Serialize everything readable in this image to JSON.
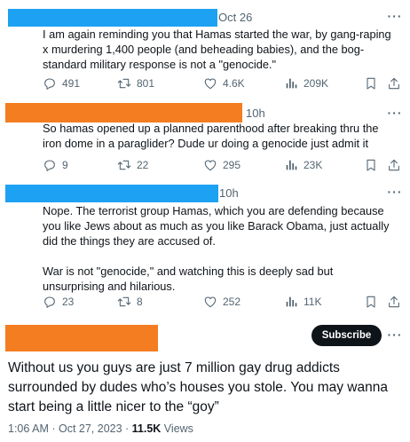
{
  "colors": {
    "blue_redaction": "#1da1f2",
    "orange_redaction": "#f47c21",
    "subscribe_bg": "#0f1419",
    "secondary_text": "#536471"
  },
  "icons": [
    "reply-icon",
    "retweet-icon",
    "like-icon",
    "views-icon",
    "bookmark-icon",
    "share-icon",
    "more-icon"
  ],
  "thread": [
    {
      "time": "Oct 26",
      "paragraphs": [
        "I am again reminding you that Hamas started the war, by gang-raping x murdering 1,400 people (and beheading babies), and the bog-standard military response is not a \"genocide.\""
      ],
      "replies": "491",
      "reposts": "801",
      "likes": "4.6K",
      "views": "209K"
    },
    {
      "time": "10h",
      "paragraphs": [
        "So hamas opened up a planned parenthood after breaking thru the iron dome in a paraglider? Dude ur doing a genocide just admit it"
      ],
      "replies": "9",
      "reposts": "22",
      "likes": "295",
      "views": "23K"
    },
    {
      "time": "10h",
      "paragraphs": [
        "Nope. The terrorist group Hamas, which you are defending because you like Jews about as much as you like Barack Obama, just actually did the things they are accused of.",
        "War is not \"genocide,\" and watching this is deeply sad but unsurprising and hilarious."
      ],
      "replies": "23",
      "reposts": "8",
      "likes": "252",
      "views": "11K"
    }
  ],
  "main": {
    "subscribe_label": "Subscribe",
    "text": "Without us you guys are just 7 million gay drug addicts surrounded by dudes who’s houses you stole. You may wanna start being a little nicer to the “goy”",
    "timestamp": "1:06 AM · Oct 27, 2023 · ",
    "views_count": "11.5K",
    "views_label": " Views"
  }
}
